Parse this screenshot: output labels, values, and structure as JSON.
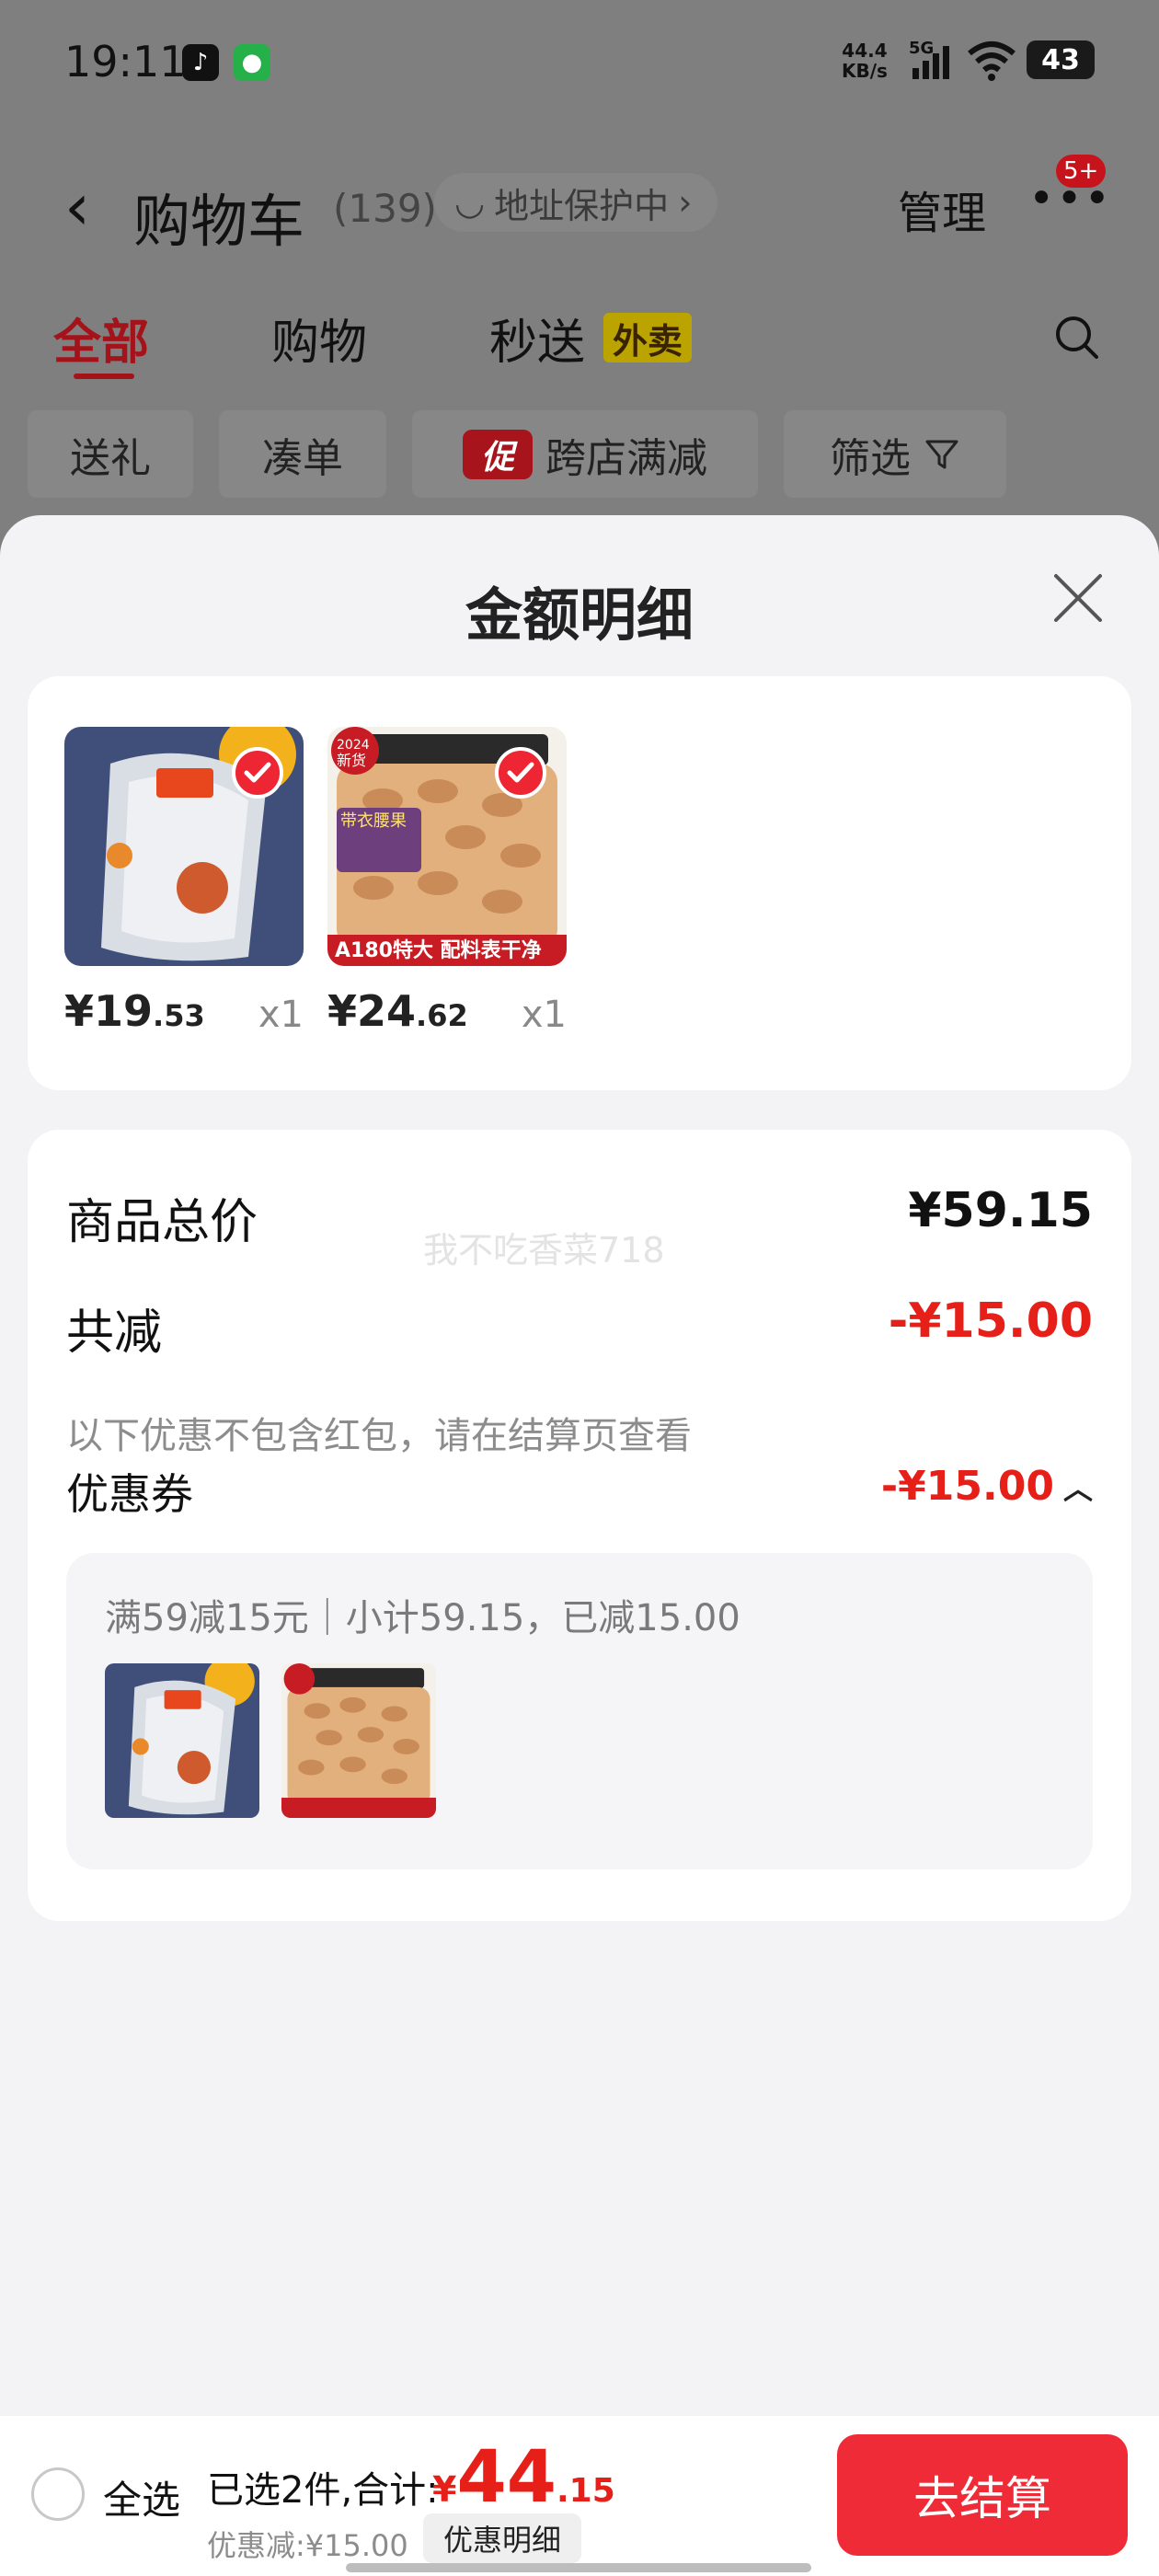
{
  "status_bar": {
    "time": "19:11",
    "net_speed_top": "44.4",
    "net_speed_unit": "KB/s",
    "network": "5G",
    "battery": "43",
    "app_icons": [
      "tiktok-icon",
      "wechat-icon"
    ]
  },
  "nav": {
    "title": "购物车",
    "count": "(139)",
    "address_protect": "地址保护中",
    "manage": "管理",
    "more_badge": "5+"
  },
  "tabs": [
    {
      "label": "全部",
      "active": true
    },
    {
      "label": "购物",
      "active": false
    },
    {
      "label": "秒送",
      "active": false,
      "tag": "外卖"
    }
  ],
  "chips": {
    "gift": "送礼",
    "bundle": "凑单",
    "promo_tag": "促",
    "cross_store": "跨店满减",
    "filter": "筛选"
  },
  "sheet": {
    "title": "金额明细",
    "items": [
      {
        "price_int": "¥19",
        "price_dec": ".53",
        "qty": "x1",
        "name": "peanut-bag"
      },
      {
        "price_int": "¥24",
        "price_dec": ".62",
        "qty": "x1",
        "name": "cashew-jar",
        "tag_year": "2024",
        "tag_new": "新货",
        "banner": "A180特大 配料表干净",
        "side_label": "带衣腰果"
      }
    ],
    "total_label": "商品总价",
    "total_value": "¥59.15",
    "discount_label": "共减",
    "discount_value": "-¥15.00",
    "discount_note": "以下优惠不包含红包，请在结算页查看",
    "coupon_label": "优惠券",
    "coupon_value": "-¥15.00",
    "coupon_desc": "满59减15元｜小计59.15，已减15.00",
    "watermark": "我不吃香菜718"
  },
  "bottom_bar": {
    "select_all": "全选",
    "selected_text": "已选2件,合计:",
    "currency": "¥",
    "total_int": "44",
    "total_dec": ".15",
    "discount_text": "优惠减:¥15.00",
    "detail_button": "优惠明细",
    "checkout_button": "去结算"
  },
  "colors": {
    "accent_red": "#e62019",
    "checkout_red": "#ee2b36",
    "sheet_bg": "#f3f3f5",
    "overlay": "#7f7f7f"
  }
}
